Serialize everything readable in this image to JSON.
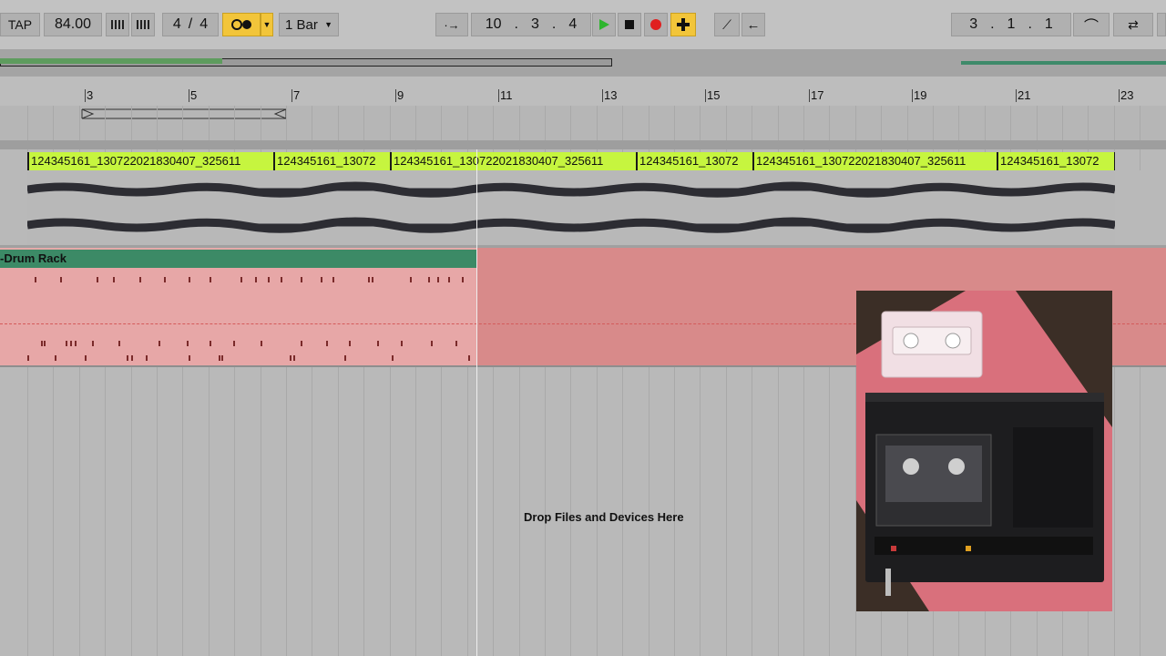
{
  "toolbar": {
    "tap_label": "TAP",
    "tempo": "84.00",
    "time_sig_num": "4",
    "time_sig_sep": "/",
    "time_sig_den": "4",
    "quantize": "1 Bar",
    "position": {
      "bar": "10",
      "beat": "3",
      "sixteenth": "4"
    },
    "loop_position": {
      "bar": "3",
      "beat": "1",
      "sixteenth": "1"
    },
    "accent_yellow": "#f2c53a",
    "play_color": "#2db52d",
    "record_color": "#e02020"
  },
  "ruler": {
    "labels": [
      "3",
      "5",
      "7",
      "9",
      "11",
      "13",
      "15",
      "17",
      "19",
      "21",
      "23"
    ]
  },
  "tracks": {
    "audio_clips": [
      "124345161_13072202183040​7_325611",
      "124345161_13072",
      "124345161_13072202183040​7_325611",
      "124345161_13072",
      "124345161_13072202183040​7_325611",
      "124345161_13072"
    ],
    "drum_clip_name": "Drum Rack"
  },
  "drop_zone": {
    "label": "Drop Files and Devices Here"
  }
}
